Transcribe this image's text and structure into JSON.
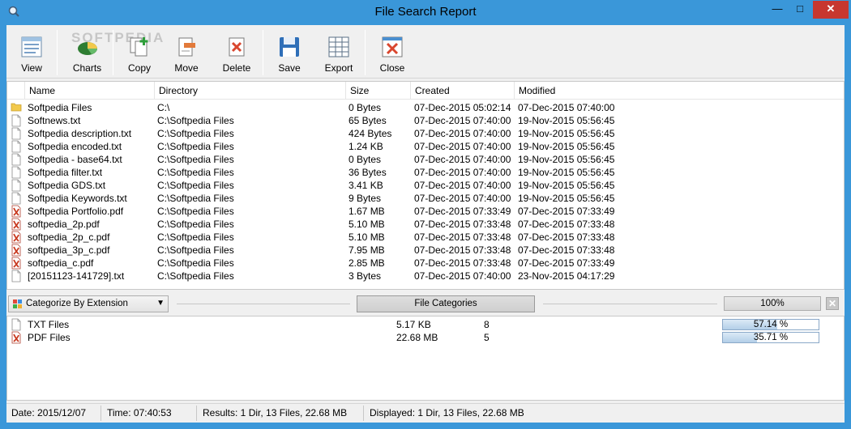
{
  "window": {
    "title": "File Search Report"
  },
  "watermark": "SOFTPEDIA",
  "toolbar": {
    "buttons": [
      {
        "label": "View",
        "icon": "view-icon"
      },
      {
        "label": "Charts",
        "icon": "charts-icon"
      },
      {
        "label": "Copy",
        "icon": "copy-icon"
      },
      {
        "label": "Move",
        "icon": "move-icon"
      },
      {
        "label": "Delete",
        "icon": "delete-icon"
      },
      {
        "label": "Save",
        "icon": "save-icon"
      },
      {
        "label": "Export",
        "icon": "export-icon"
      },
      {
        "label": "Close",
        "icon": "close-icon"
      }
    ]
  },
  "file_list": {
    "columns": [
      "Name",
      "Directory",
      "Size",
      "Created",
      "Modified"
    ],
    "rows": [
      {
        "type": "folder",
        "name": "Softpedia Files",
        "dir": "C:\\",
        "size": "0 Bytes",
        "created": "07-Dec-2015 05:02:14",
        "modified": "07-Dec-2015 07:40:00"
      },
      {
        "type": "txt",
        "name": "Softnews.txt",
        "dir": "C:\\Softpedia Files",
        "size": "65 Bytes",
        "created": "07-Dec-2015 07:40:00",
        "modified": "19-Nov-2015 05:56:45"
      },
      {
        "type": "txt",
        "name": "Softpedia description.txt",
        "dir": "C:\\Softpedia Files",
        "size": "424 Bytes",
        "created": "07-Dec-2015 07:40:00",
        "modified": "19-Nov-2015 05:56:45"
      },
      {
        "type": "txt",
        "name": "Softpedia encoded.txt",
        "dir": "C:\\Softpedia Files",
        "size": "1.24 KB",
        "created": "07-Dec-2015 07:40:00",
        "modified": "19-Nov-2015 05:56:45"
      },
      {
        "type": "txt",
        "name": "Softpedia - base64.txt",
        "dir": "C:\\Softpedia Files",
        "size": "0 Bytes",
        "created": "07-Dec-2015 07:40:00",
        "modified": "19-Nov-2015 05:56:45"
      },
      {
        "type": "txt",
        "name": "Softpedia filter.txt",
        "dir": "C:\\Softpedia Files",
        "size": "36 Bytes",
        "created": "07-Dec-2015 07:40:00",
        "modified": "19-Nov-2015 05:56:45"
      },
      {
        "type": "txt",
        "name": "Softpedia GDS.txt",
        "dir": "C:\\Softpedia Files",
        "size": "3.41 KB",
        "created": "07-Dec-2015 07:40:00",
        "modified": "19-Nov-2015 05:56:45"
      },
      {
        "type": "txt",
        "name": "Softpedia Keywords.txt",
        "dir": "C:\\Softpedia Files",
        "size": "9 Bytes",
        "created": "07-Dec-2015 07:40:00",
        "modified": "19-Nov-2015 05:56:45"
      },
      {
        "type": "pdf",
        "name": "Softpedia Portfolio.pdf",
        "dir": "C:\\Softpedia Files",
        "size": "1.67 MB",
        "created": "07-Dec-2015 07:33:49",
        "modified": "07-Dec-2015 07:33:49"
      },
      {
        "type": "pdf",
        "name": "softpedia_2p.pdf",
        "dir": "C:\\Softpedia Files",
        "size": "5.10 MB",
        "created": "07-Dec-2015 07:33:48",
        "modified": "07-Dec-2015 07:33:48"
      },
      {
        "type": "pdf",
        "name": "softpedia_2p_c.pdf",
        "dir": "C:\\Softpedia Files",
        "size": "5.10 MB",
        "created": "07-Dec-2015 07:33:48",
        "modified": "07-Dec-2015 07:33:48"
      },
      {
        "type": "pdf",
        "name": "softpedia_3p_c.pdf",
        "dir": "C:\\Softpedia Files",
        "size": "7.95 MB",
        "created": "07-Dec-2015 07:33:48",
        "modified": "07-Dec-2015 07:33:48"
      },
      {
        "type": "pdf",
        "name": "softpedia_c.pdf",
        "dir": "C:\\Softpedia Files",
        "size": "2.85 MB",
        "created": "07-Dec-2015 07:33:48",
        "modified": "07-Dec-2015 07:33:49"
      },
      {
        "type": "txt",
        "name": "[20151123-141729].txt",
        "dir": "C:\\Softpedia Files",
        "size": "3 Bytes",
        "created": "07-Dec-2015 07:40:00",
        "modified": "23-Nov-2015 04:17:29"
      }
    ]
  },
  "categorize": {
    "selected": "Categorize By Extension",
    "button_label": "File Categories",
    "percent_label": "100%"
  },
  "categories": [
    {
      "type": "txt",
      "name": "TXT Files",
      "size": "5.17 KB",
      "count": "8",
      "percent_label": "57.14 %",
      "fraction": 0.5714
    },
    {
      "type": "pdf",
      "name": "PDF Files",
      "size": "22.68 MB",
      "count": "5",
      "percent_label": "35.71 %",
      "fraction": 0.3571
    }
  ],
  "status": {
    "date": "Date: 2015/12/07",
    "time": "Time: 07:40:53",
    "results": "Results: 1 Dir, 13 Files, 22.68 MB",
    "displayed": "Displayed: 1 Dir, 13 Files, 22.68 MB"
  },
  "colors": {
    "titlebar": "#3a97d9",
    "close_button": "#c7372f",
    "folder": "#f2c94c",
    "pdf": "#c8391f"
  }
}
